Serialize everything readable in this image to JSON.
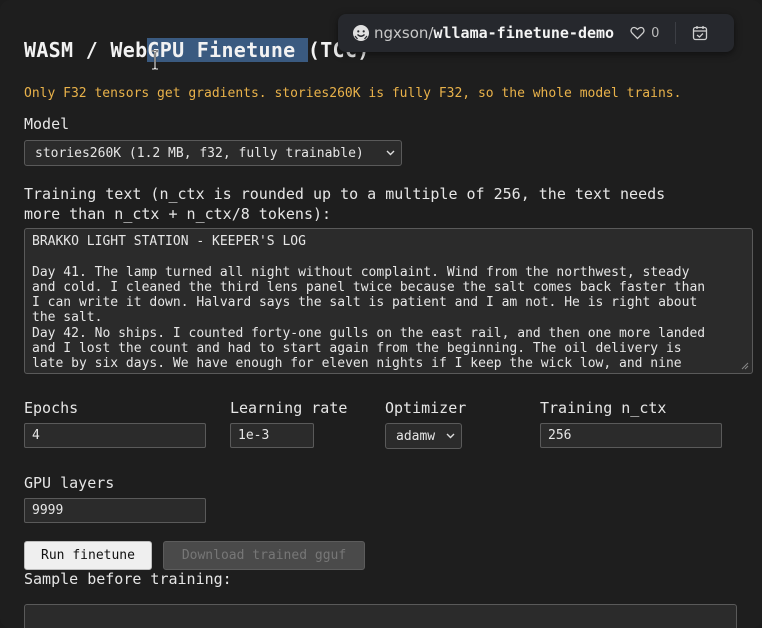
{
  "title": {
    "part1": "WASM / Web",
    "part2_selected": "GPU Finetune ",
    "part3": "(TCC)"
  },
  "hf_badge": {
    "owner": "ngxson",
    "slash": "/",
    "repo": "wllama-finetune-demo",
    "likes": "0"
  },
  "notice": "Only F32 tensors get gradients. stories260K is fully F32, so the whole model trains.",
  "model": {
    "label": "Model",
    "selected": "stories260K (1.2 MB, f32, fully trainable)"
  },
  "training_text": {
    "label_line1": "Training text (n_ctx is rounded up to a multiple of 256, the text needs",
    "label_line2": "more than n_ctx + n_ctx/8 tokens):",
    "value": "BRAKKO LIGHT STATION - KEEPER'S LOG\n\nDay 41. The lamp turned all night without complaint. Wind from the northwest, steady\nand cold. I cleaned the third lens panel twice because the salt comes back faster than\nI can write it down. Halvard says the salt is patient and I am not. He is right about\nthe salt.\nDay 42. No ships. I counted forty-one gulls on the east rail, and then one more landed\nand I lost the count and had to start again from the beginning. The oil delivery is\nlate by six days. We have enough for eleven nights if I keep the wick low, and nine"
  },
  "epochs": {
    "label": "Epochs",
    "value": "4"
  },
  "learning_rate": {
    "label": "Learning rate",
    "value": "1e-3"
  },
  "optimizer": {
    "label": "Optimizer",
    "selected": "adamw"
  },
  "training_n_ctx": {
    "label": "Training n_ctx",
    "value": "256"
  },
  "gpu_layers": {
    "label": "GPU layers",
    "value": "9999"
  },
  "buttons": {
    "run": "Run finetune",
    "download": "Download trained gguf"
  },
  "sample": {
    "label": "Sample before training:"
  },
  "colors": {
    "background": "#1e1e1e",
    "notice": "#e9b24a",
    "selection": "#3a5a80"
  }
}
